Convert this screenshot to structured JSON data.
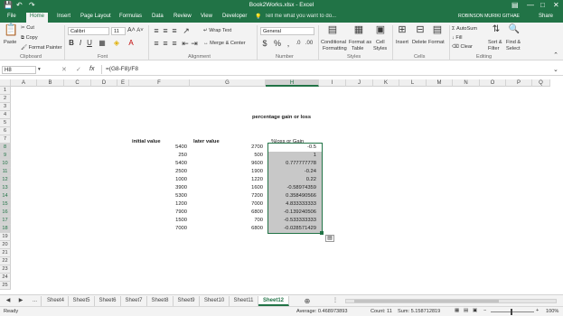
{
  "window": {
    "title": "Book2Works.xlsx - Excel",
    "user": "ROBINSON MURIKI GITHAE",
    "share": "Share",
    "tell_me": "Tell me what you want to do..."
  },
  "ribbon_tabs": [
    "File",
    "Home",
    "Insert",
    "Page Layout",
    "Formulas",
    "Data",
    "Review",
    "View",
    "Developer"
  ],
  "active_tab": "Home",
  "clipboard": {
    "paste": "Paste",
    "cut": "Cut",
    "copy": "Copy",
    "format_painter": "Format Painter",
    "group": "Clipboard"
  },
  "font": {
    "name": "Calibri",
    "size": "11",
    "group": "Font"
  },
  "alignment": {
    "wrap": "Wrap Text",
    "merge": "Merge & Center",
    "group": "Alignment"
  },
  "number": {
    "format": "General",
    "group": "Number"
  },
  "styles": {
    "cond1": "Conditional",
    "cond2": "Formatting",
    "fmt1": "Format as",
    "fmt2": "Table",
    "cell1": "Cell",
    "cell2": "Styles",
    "group": "Styles"
  },
  "cells": {
    "insert": "Insert",
    "delete": "Delete",
    "format": "Format",
    "group": "Cells"
  },
  "editing": {
    "autosum": "AutoSum",
    "fill": "Fill",
    "clear": "Clear",
    "sort1": "Sort &",
    "sort2": "Filter",
    "find1": "Find &",
    "find2": "Select",
    "group": "Editing"
  },
  "formula_bar": {
    "name_box": "H8",
    "fx": "fx",
    "formula": "=(G8-F8)/F8"
  },
  "columns": [
    "A",
    "B",
    "C",
    "D",
    "E",
    "F",
    "G",
    "H",
    "I",
    "J",
    "K",
    "L",
    "M",
    "N",
    "O",
    "P",
    "Q"
  ],
  "rows": [
    "1",
    "2",
    "3",
    "4",
    "5",
    "6",
    "7",
    "8",
    "9",
    "10",
    "11",
    "12",
    "13",
    "14",
    "15",
    "16",
    "17",
    "18",
    "19",
    "20",
    "21",
    "22",
    "23",
    "24",
    "25"
  ],
  "sheet": {
    "title": "percentage gain or loss",
    "header_initial": "initial value",
    "header_later": "later value",
    "header_pct": "%loss or Gain",
    "data": [
      {
        "f": "5400",
        "g": "2700",
        "h": "-0.5"
      },
      {
        "f": "250",
        "g": "500",
        "h": "1"
      },
      {
        "f": "5400",
        "g": "9600",
        "h": "0.777777778"
      },
      {
        "f": "2500",
        "g": "1900",
        "h": "-0.24"
      },
      {
        "f": "1000",
        "g": "1220",
        "h": "0.22"
      },
      {
        "f": "3900",
        "g": "1600",
        "h": "-0.58974359"
      },
      {
        "f": "5300",
        "g": "7200",
        "h": "0.358490566"
      },
      {
        "f": "1200",
        "g": "7000",
        "h": "4.833333333"
      },
      {
        "f": "7900",
        "g": "6800",
        "h": "-0.139240506"
      },
      {
        "f": "1500",
        "g": "700",
        "h": "-0.533333333"
      },
      {
        "f": "7000",
        "g": "6800",
        "h": "-0.028571429"
      }
    ]
  },
  "sheet_tabs": [
    "Sheet4",
    "Sheet5",
    "Sheet6",
    "Sheet7",
    "Sheet8",
    "Sheet9",
    "Sheet10",
    "Sheet11",
    "Sheet12"
  ],
  "active_sheet": "Sheet12",
  "status": {
    "ready": "Ready",
    "average": "Average: 0.468973893",
    "count": "Count: 11",
    "sum": "Sum: 5.158712819",
    "zoom": "100%"
  },
  "colors": {
    "brand": "#217346",
    "selection": "#c6c6c6"
  }
}
